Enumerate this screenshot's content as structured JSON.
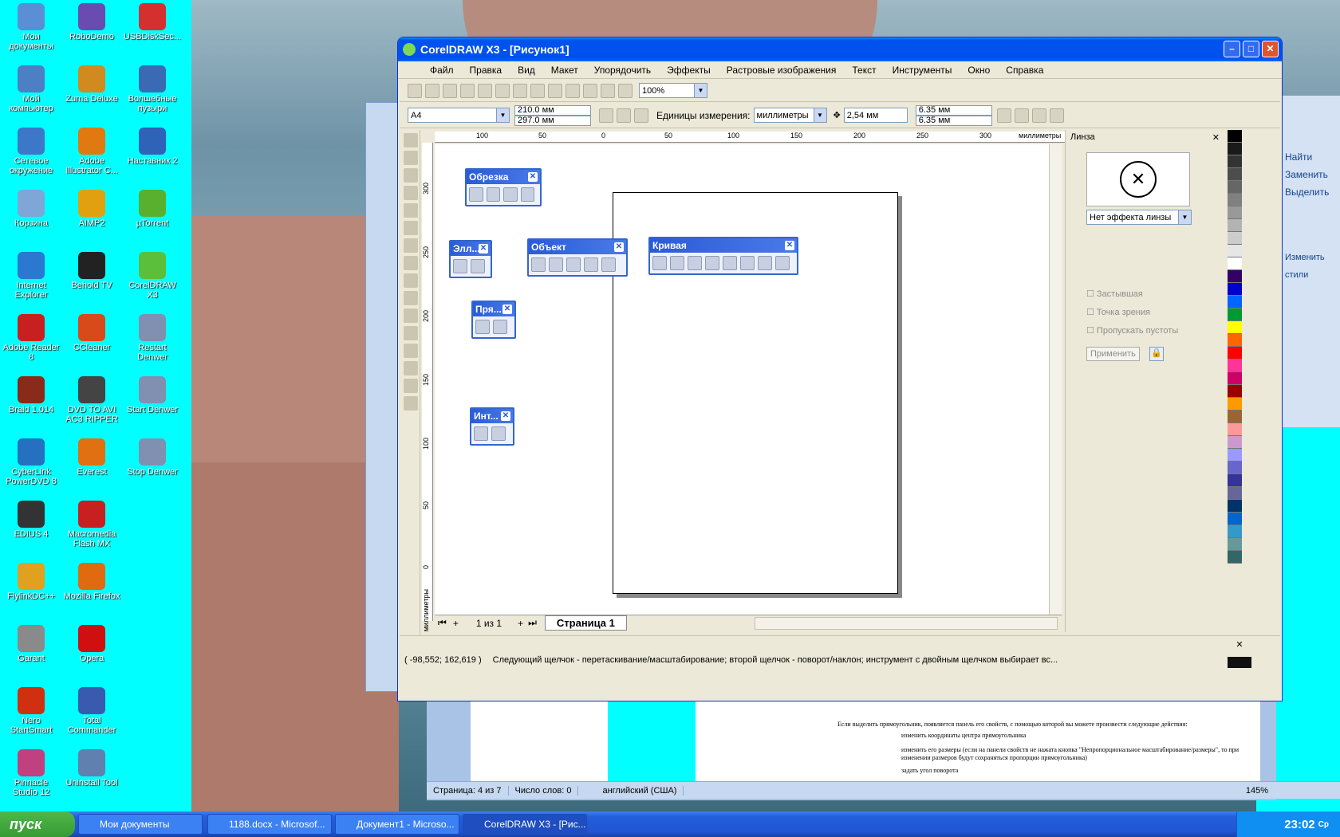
{
  "desktop": {
    "icons": [
      {
        "label": "Мои документы",
        "icon": "folder-icon",
        "color": "#5a8fd6"
      },
      {
        "label": "RoboDemo",
        "icon": "robodemo-icon",
        "color": "#6a4bb0"
      },
      {
        "label": "USBDiskSec...",
        "icon": "usb-icon",
        "color": "#d43030"
      },
      {
        "label": "Мой компьютер",
        "icon": "computer-icon",
        "color": "#4c7fc4"
      },
      {
        "label": "Zuma Deluxe",
        "icon": "zuma-icon",
        "color": "#d08a20"
      },
      {
        "label": "Волшебные пузыри",
        "icon": "bubbles-icon",
        "color": "#3b6ab5"
      },
      {
        "label": "Сетевое окружение",
        "icon": "network-icon",
        "color": "#3d77c7"
      },
      {
        "label": "Adobe Illustrator C...",
        "icon": "illustrator-icon",
        "color": "#e07a10"
      },
      {
        "label": "Наставник 2",
        "icon": "nastavnik-icon",
        "color": "#2f63b8"
      },
      {
        "label": "Корзина",
        "icon": "recycle-bin-icon",
        "color": "#7ea6d6"
      },
      {
        "label": "AIMP2",
        "icon": "aimp-icon",
        "color": "#e0a010"
      },
      {
        "label": "µTorrent",
        "icon": "utorrent-icon",
        "color": "#58b02e"
      },
      {
        "label": "Internet Explorer",
        "icon": "ie-icon",
        "color": "#2a78d0"
      },
      {
        "label": "Behold TV",
        "icon": "behold-tv-icon",
        "color": "#222"
      },
      {
        "label": "CorelDRAW X3",
        "icon": "coreldraw-icon",
        "color": "#5cbf3c"
      },
      {
        "label": "Adobe Reader 8",
        "icon": "adobe-reader-icon",
        "color": "#c82020"
      },
      {
        "label": "CCleaner",
        "icon": "ccleaner-icon",
        "color": "#d84a1a"
      },
      {
        "label": "Restart Denwer",
        "icon": "denwer-icon",
        "color": "#8090b0"
      },
      {
        "label": "Braid 1.014",
        "icon": "braid-icon",
        "color": "#8a2a1a"
      },
      {
        "label": "DVD TO AVI AC3 RIPPER",
        "icon": "dvd-icon",
        "color": "#444"
      },
      {
        "label": "Start Denwer",
        "icon": "denwer-icon",
        "color": "#8090b0"
      },
      {
        "label": "CyberLink PowerDVD 8",
        "icon": "powerdvd-icon",
        "color": "#2670c0"
      },
      {
        "label": "Everest",
        "icon": "everest-icon",
        "color": "#e07010"
      },
      {
        "label": "Stop Denwer",
        "icon": "denwer-icon",
        "color": "#8090b0"
      },
      {
        "label": "EDIUS 4",
        "icon": "edius-icon",
        "color": "#333"
      },
      {
        "label": "Macromedia Flash MX",
        "icon": "flash-icon",
        "color": "#c82020"
      },
      {
        "label": "",
        "icon": "",
        "color": ""
      },
      {
        "label": "FlylinkDC++",
        "icon": "flylink-icon",
        "color": "#e0a020"
      },
      {
        "label": "Mozilla Firefox",
        "icon": "firefox-icon",
        "color": "#e06a10"
      },
      {
        "label": "",
        "icon": "",
        "color": ""
      },
      {
        "label": "Garant",
        "icon": "garant-icon",
        "color": "#8a8a8a"
      },
      {
        "label": "Opera",
        "icon": "opera-icon",
        "color": "#d01010"
      },
      {
        "label": "",
        "icon": "",
        "color": ""
      },
      {
        "label": "Nero StartSmart",
        "icon": "nero-icon",
        "color": "#d03010"
      },
      {
        "label": "Total Commander",
        "icon": "total-commander-icon",
        "color": "#3a5ab0"
      },
      {
        "label": "",
        "icon": "",
        "color": ""
      },
      {
        "label": "Pinnacle Studio 12",
        "icon": "pinnacle-icon",
        "color": "#c04080"
      },
      {
        "label": "Uninstall Tool",
        "icon": "uninstall-icon",
        "color": "#6080b0"
      }
    ]
  },
  "corel": {
    "title": "CorelDRAW X3 - [Рисунок1]",
    "menu": [
      "Файл",
      "Правка",
      "Вид",
      "Макет",
      "Упорядочить",
      "Эффекты",
      "Растровые изображения",
      "Текст",
      "Инструменты",
      "Окно",
      "Справка"
    ],
    "zoom": "100%",
    "paper": "A4",
    "width": "210.0 мм",
    "height": "297.0 мм",
    "units_label": "Единицы измерения:",
    "units_value": "миллиметры",
    "nudge": "2,54 мм",
    "dup_x": "6.35 мм",
    "dup_y": "6.35 мм",
    "ruler_top_labels": [
      "100",
      "50",
      "0",
      "50",
      "100",
      "150",
      "200",
      "250",
      "300",
      "миллиметры"
    ],
    "ruler_left_labels": [
      "300",
      "250",
      "200",
      "150",
      "100",
      "50",
      "0",
      "миллиметры"
    ],
    "floating_bars": {
      "crop": "Обрезка",
      "ellipse": "Элл...",
      "object": "Объект",
      "curve": "Кривая",
      "rect": "Пря...",
      "interactive": "Инт..."
    },
    "page_counter": "1 из 1",
    "page_tab": "Страница 1",
    "docker": {
      "title": "Линза",
      "lens_value": "Нет эффекта линзы",
      "options": [
        "Застывшая",
        "Точка зрения",
        "Пропускать пустоты"
      ],
      "apply": "Применить"
    },
    "status": {
      "coords": "( -98,552; 162,619 )",
      "hint": "Следующий щелчок - перетаскивание/масштабирование; второй щелчок - поворот/наклон; инструмент с двойным щелчком выбирает вс..."
    },
    "palette": [
      "#000000",
      "#1a1a1a",
      "#333333",
      "#4d4d4d",
      "#666666",
      "#808080",
      "#999999",
      "#b3b3b3",
      "#cccccc",
      "#e6e6e6",
      "#ffffff",
      "#330066",
      "#0000cc",
      "#0066ff",
      "#009933",
      "#ffff00",
      "#ff6600",
      "#ff0000",
      "#ff3399",
      "#cc0066",
      "#990000",
      "#ff9900",
      "#996633",
      "#ff9999",
      "#cc99cc",
      "#9999ff",
      "#6666cc",
      "#333399",
      "#666699",
      "#003366",
      "#0066cc",
      "#3399cc",
      "#669999",
      "#336666"
    ]
  },
  "word": {
    "page": "Страница: 4 из 7",
    "words": "Число слов: 0",
    "lang": "английский (США)",
    "zoom": "145%",
    "ribbon": [
      "Найти",
      "Заменить",
      "Выделить",
      "Изменить стили"
    ],
    "doc_lines": [
      "Если выделить прямоугольник, появляется панель его свойств, с помощью которой вы можете произвести следующие действия:",
      "изменить координаты центра прямоугольника",
      "изменить его размеры (если на панели свойств не нажата кнопка \"Непропорциональное масштабирование/размеры\", то при изменении размеров будут сохраняться пропорции прямоугольника)",
      "задать угол поворота"
    ]
  },
  "taskbar": {
    "start": "пуск",
    "tasks": [
      "Мои документы",
      "1188.docx - Microsof...",
      "Документ1 - Microso...",
      "CorelDRAW X3 - [Рис..."
    ],
    "clock": "23:02",
    "day": "Ср"
  }
}
